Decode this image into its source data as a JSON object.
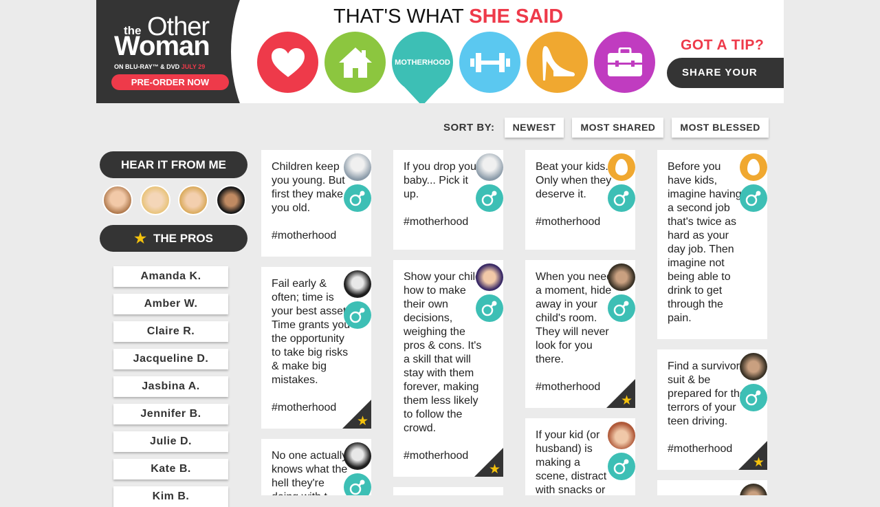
{
  "brand": {
    "logo_the": "the",
    "logo_other": "Other",
    "logo_woman": "Woman",
    "subline": "ON BLU-RAY™ & DVD ",
    "subline_date": "JULY 29",
    "preorder": "PRE-ORDER NOW"
  },
  "header": {
    "title_prefix": "THAT'S WHAT ",
    "title_accent": "SHE SAID",
    "tip": "GOT A TIP?",
    "share": "SHARE YOUR ADVICE"
  },
  "categories": [
    {
      "icon": "heart-icon",
      "color": "#ee3a4a"
    },
    {
      "icon": "house-icon",
      "color": "#8cc63f"
    },
    {
      "icon": "motherhood",
      "label": "MOTHERHOOD",
      "color": "#3dbfb5",
      "active": true
    },
    {
      "icon": "dumbbell-icon",
      "color": "#5bc8f0"
    },
    {
      "icon": "high-heel-icon",
      "color": "#f0a830"
    },
    {
      "icon": "briefcase-icon",
      "color": "#c03cc0"
    }
  ],
  "sort": {
    "label": "SORT BY:",
    "options": [
      "NEWEST",
      "MOST SHARED",
      "MOST BLESSED"
    ]
  },
  "sidebar": {
    "hear_label": "HEAR IT FROM ME",
    "pros_label": "THE PROS",
    "pros": [
      "Amanda K.",
      "Amber W.",
      "Claire R.",
      "Jacqueline D.",
      "Jasbina A.",
      "Jennifer B.",
      "Julie D.",
      "Kate B.",
      "Kim B."
    ]
  },
  "cards": [
    {
      "text": "Children keep you young. But first they make you old.\n\n#motherhood",
      "starred": false
    },
    {
      "text": "Fail early & often; time is your best asset. Time grants you the opportunity to take big risks & make big mistakes.\n\n#motherhood",
      "starred": true
    },
    {
      "text": "No one actually knows what the hell they're doing with t",
      "starred": false
    },
    {
      "text": "If you drop your baby... Pick it up.\n\n#motherhood",
      "starred": false
    },
    {
      "text": "Show your child how to make their own decisions, weighing the pros & cons. It's a skill that will stay with them forever, making them less likely to follow the crowd.\n\n#motherhood",
      "starred": true
    },
    {
      "text": "Beat your kids. Only when they deserve it.\n\n#motherhood",
      "starred": false
    },
    {
      "text": "When you need a moment, hide away in your child's room. They will never look for you there.\n\n#motherhood",
      "starred": true
    },
    {
      "text": "If your kid (or husband) is making a scene, distract with snacks or",
      "starred": false
    },
    {
      "text": "Before you have kids, imagine having a second job that's twice as hard as your day job. Then imagine not being able to drink to get through the pain.\n\n#motherhood",
      "starred": false
    },
    {
      "text": "Find a survivor suit & be prepared for the terrors of your teen driving.\n\n#motherhood",
      "starred": true
    }
  ],
  "colors": {
    "accent": "#ee3a4a",
    "dark": "#343434",
    "teal": "#3dbfb5",
    "star": "#f4c20d"
  }
}
